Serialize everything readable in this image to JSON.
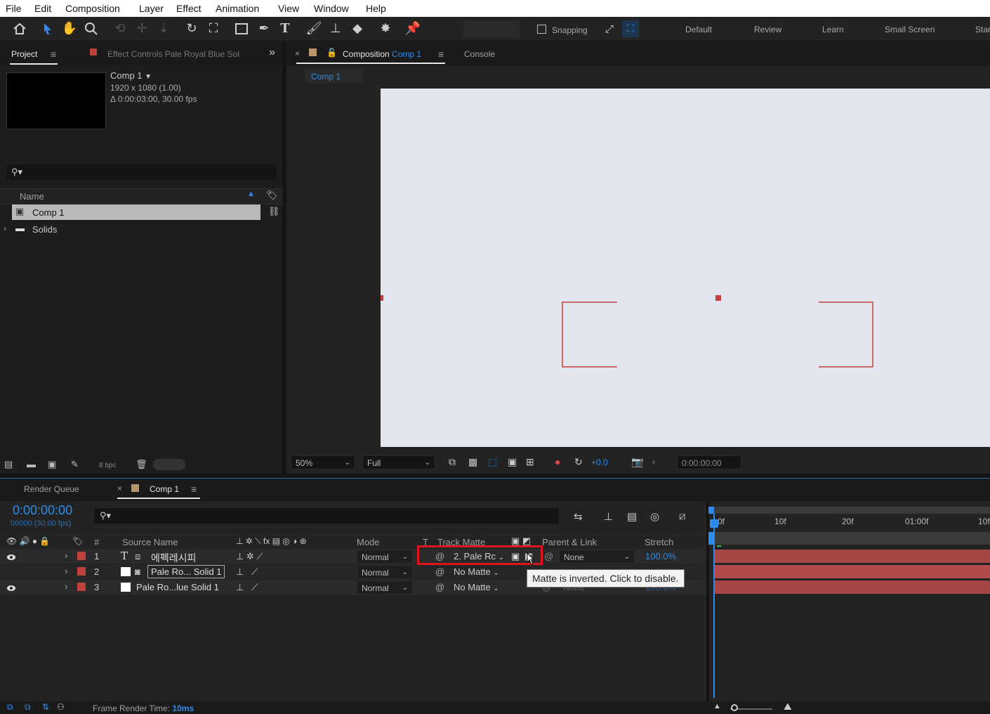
{
  "menu": [
    "File",
    "Edit",
    "Composition",
    "Layer",
    "Effect",
    "Animation",
    "View",
    "Window",
    "Help"
  ],
  "toolbar": {
    "snapping_label": "Snapping",
    "workspaces": [
      "Default",
      "Review",
      "Learn",
      "Small Screen",
      "Star"
    ]
  },
  "project_panel": {
    "tab_label": "Project",
    "effect_controls_label": "Effect Controls",
    "effect_controls_target": "Pale Royal Blue Sol",
    "comp_name": "Comp 1",
    "comp_size": "1920 x 1080 (1.00)",
    "comp_duration": "Δ 0:00:03:00, 30.00 fps",
    "search_placeholder": "",
    "column_name": "Name",
    "items": [
      {
        "name": "Comp 1",
        "selected": true
      },
      {
        "name": "Solids",
        "selected": false
      }
    ],
    "bpc": "8 bpc"
  },
  "composition_panel": {
    "tab_prefix": "Composition",
    "tab_comp": "Comp 1",
    "console_tab": "Console",
    "breadcrumb": "Comp 1",
    "zoom": "50%",
    "resolution": "Full",
    "exposure": "+0.0",
    "timecode": "0:00:00:00",
    "canvas_color": "#e3e6ee",
    "shape_color": "#c0413c"
  },
  "timeline": {
    "render_queue_tab": "Render Queue",
    "comp_tab": "Comp 1",
    "timecode": "0:00:00:00",
    "frame_info": "00000 (30.00 fps)",
    "columns": {
      "number": "#",
      "source_name": "Source Name",
      "mode": "Mode",
      "t": "T",
      "track_matte": "Track Matte",
      "parent_link": "Parent & Link",
      "stretch": "Stretch"
    },
    "ruler": [
      "0f",
      "10f",
      "20f",
      "01:00f",
      "10f"
    ],
    "layers": [
      {
        "num": "1",
        "type_icon": "T",
        "name": "에펙레시피",
        "mode": "Normal",
        "matte": "2. Pale Rc",
        "parent": "None",
        "stretch": "100.0%",
        "visible": true
      },
      {
        "num": "2",
        "type_icon": "",
        "name": "Pale Ro... Solid 1",
        "mode": "Normal",
        "matte": "No Matte",
        "parent": "None",
        "stretch": "100.0%",
        "visible": false
      },
      {
        "num": "3",
        "type_icon": "",
        "name": "Pale Ro...lue Solid 1",
        "mode": "Normal",
        "matte": "No Matte",
        "parent": "None",
        "stretch": "100.0%",
        "visible": true
      }
    ],
    "tooltip": "Matte is inverted. Click to disable.",
    "frame_render_label": "Frame Render Time:",
    "frame_render_value": "10ms",
    "label_color": "#c0413c",
    "highlight_color": "#e0141c"
  }
}
